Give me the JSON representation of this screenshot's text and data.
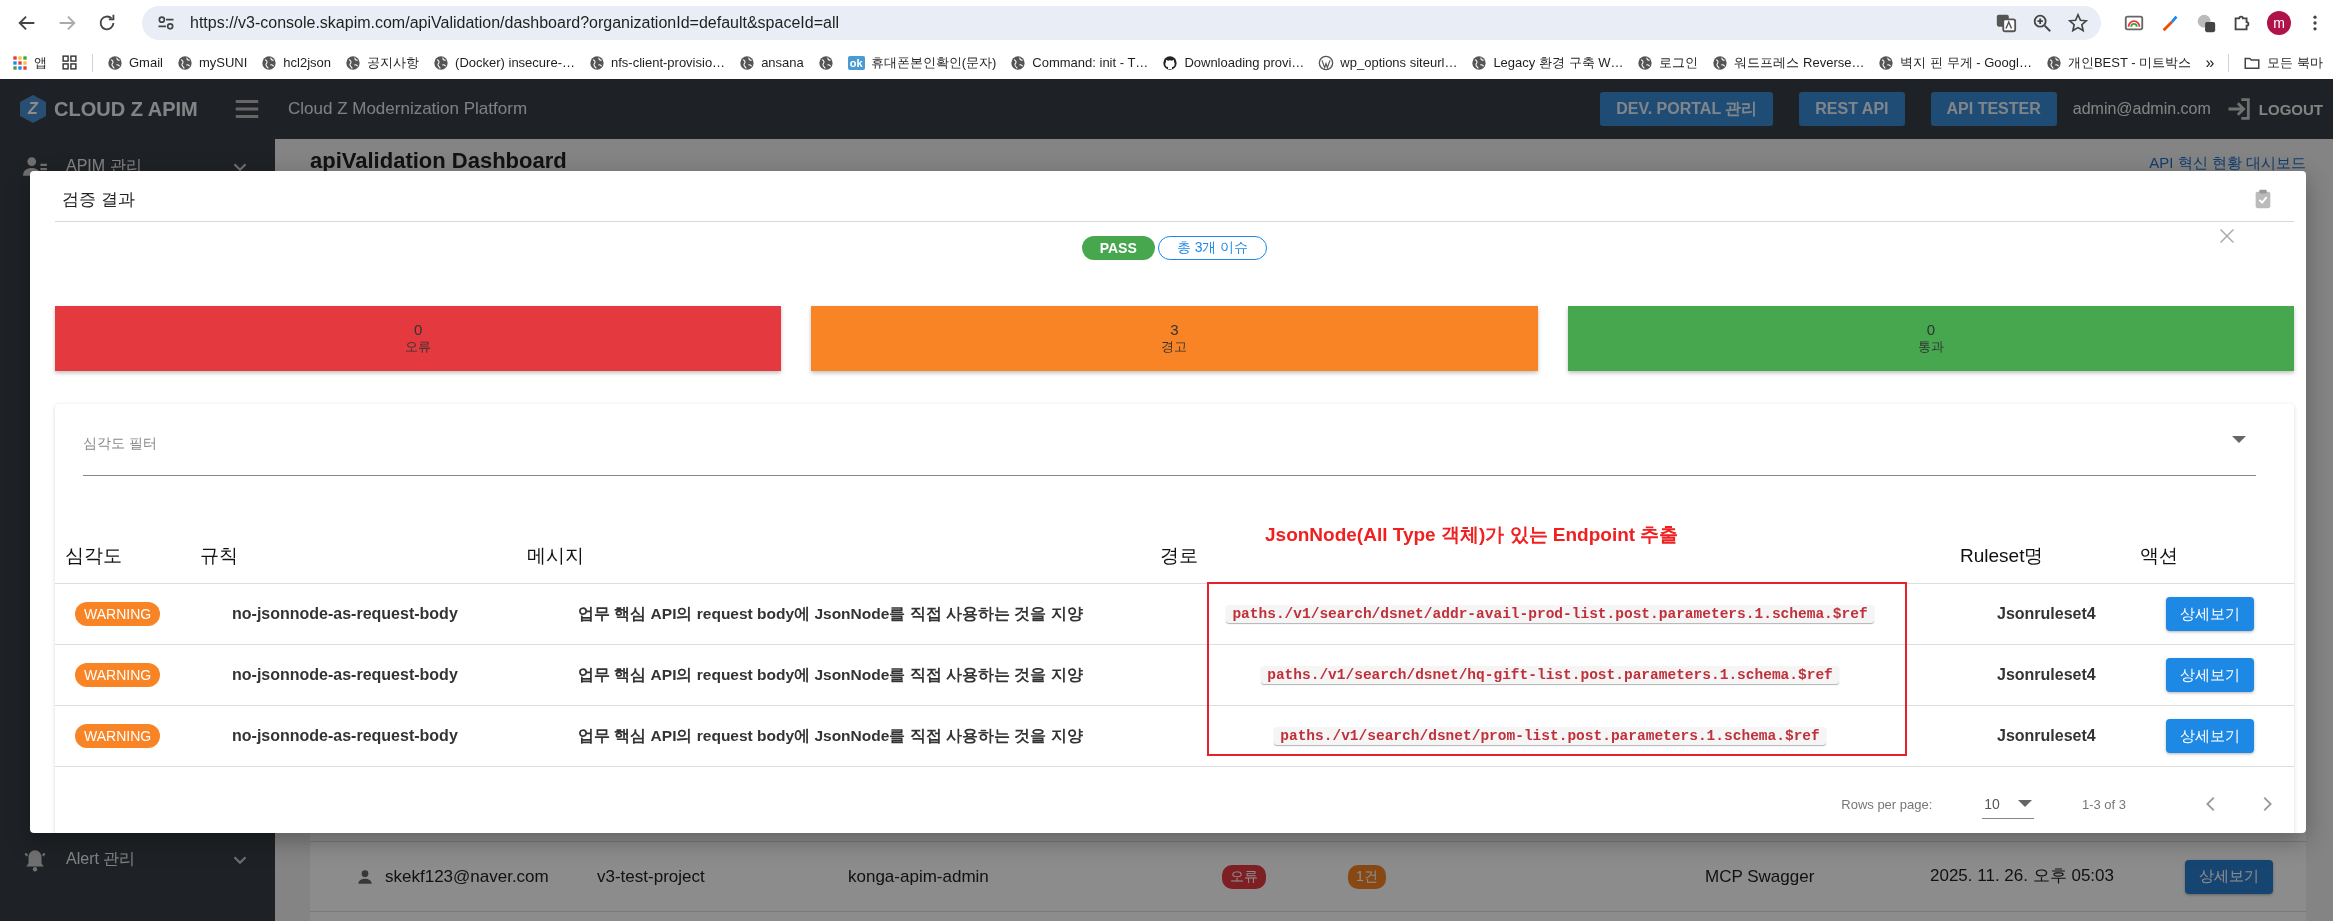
{
  "browser": {
    "url": "https://v3-console.skapim.com/apiValidation/dashboard?organizationId=default&spaceId=all",
    "profile": "m",
    "apps_label": "앱",
    "bookmarks": [
      {
        "kind": "globe",
        "label": "Gmail"
      },
      {
        "kind": "globe",
        "label": "mySUNI"
      },
      {
        "kind": "globe",
        "label": "hcl2json"
      },
      {
        "kind": "globe",
        "label": "공지사항"
      },
      {
        "kind": "globe",
        "label": "(Docker) insecure-…"
      },
      {
        "kind": "globe",
        "label": "nfs-client-provisio…"
      },
      {
        "kind": "globe",
        "label": "ansana"
      },
      {
        "kind": "globe"
      },
      {
        "kind": "badge",
        "badge": "ok",
        "label": "휴대폰본인확인(문자)"
      },
      {
        "kind": "globe",
        "label": "Command: init - T…"
      },
      {
        "kind": "cat",
        "label": "Downloading provi…"
      },
      {
        "kind": "wp",
        "label": "wp_options siteurl…"
      },
      {
        "kind": "globe",
        "label": "Legacy 환경 구축 W…"
      },
      {
        "kind": "globe",
        "label": "로그인"
      },
      {
        "kind": "globe",
        "label": "워드프레스 Reverse…"
      },
      {
        "kind": "globe",
        "label": "벽지 핀 무게 - Googl…"
      },
      {
        "kind": "globe",
        "label": "개인BEST - 미트박스"
      }
    ],
    "more": "»",
    "folder": "모든 북마"
  },
  "header": {
    "logo_mark": "Z",
    "logo": "CLOUD Z APIM",
    "platform": "Cloud Z Modernization Platform",
    "buttons": [
      "DEV. PORTAL 관리",
      "REST API",
      "API TESTER"
    ],
    "user": "admin@admin.com",
    "logout": "LOGOUT"
  },
  "sidebar": {
    "items": [
      {
        "kind": "person",
        "label": "APIM 관리"
      },
      {
        "kind": "bell",
        "label": "Alert 관리"
      }
    ]
  },
  "page": {
    "title": "apiValidation Dashboard",
    "link": "API 혁신 현황 대시보드",
    "rows": [
      {
        "email": "skekf123@naver.com",
        "project": "v3-test-project",
        "account": "konga-apim-admin",
        "status": {
          "text": "오류",
          "kind": "error"
        },
        "count": "1건",
        "name": "MCP Swagger",
        "date": "2025. 11. 26. 오후 05:03",
        "action": "상세보기"
      }
    ]
  },
  "modal": {
    "title": "검증 결과",
    "result": {
      "text": "PASS",
      "kind": "pass"
    },
    "issues": "총 3개 이슈",
    "summary": [
      {
        "kind": "error",
        "count": "0",
        "label": "오류"
      },
      {
        "kind": "warning",
        "count": "3",
        "label": "경고"
      },
      {
        "kind": "pass",
        "count": "0",
        "label": "통과"
      }
    ],
    "filter": {
      "placeholder": "심각도 필터"
    },
    "annotation": "JsonNode(All Type 객체)가 있는 Endpoint 추출",
    "table": {
      "columns": [
        "심각도",
        "규칙",
        "메시지",
        "경로",
        "Ruleset명",
        "액션"
      ],
      "rows": [
        {
          "severity": {
            "text": "WARNING",
            "kind": "warning"
          },
          "rule": "no-jsonnode-as-request-body",
          "message": "업무 핵심 API의 request body에 JsonNode를 직접 사용하는 것을 지양",
          "path": "paths./v1/search/dsnet/addr-avail-prod-list.post.parameters.1.schema.$ref",
          "ruleset": "Jsonruleset4",
          "action": "상세보기"
        },
        {
          "severity": {
            "text": "WARNING",
            "kind": "warning"
          },
          "rule": "no-jsonnode-as-request-body",
          "message": "업무 핵심 API의 request body에 JsonNode를 직접 사용하는 것을 지양",
          "path": "paths./v1/search/dsnet/hq-gift-list.post.parameters.1.schema.$ref",
          "ruleset": "Jsonruleset4",
          "action": "상세보기"
        },
        {
          "severity": {
            "text": "WARNING",
            "kind": "warning"
          },
          "rule": "no-jsonnode-as-request-body",
          "message": "업무 핵심 API의 request body에 JsonNode를 직접 사용하는 것을 지양",
          "path": "paths./v1/search/dsnet/prom-list.post.parameters.1.schema.$ref",
          "ruleset": "Jsonruleset4",
          "action": "상세보기"
        }
      ]
    },
    "pagination": {
      "rows_label": "Rows per page:",
      "rows_per_page": "10",
      "range": "1-3 of 3"
    }
  }
}
